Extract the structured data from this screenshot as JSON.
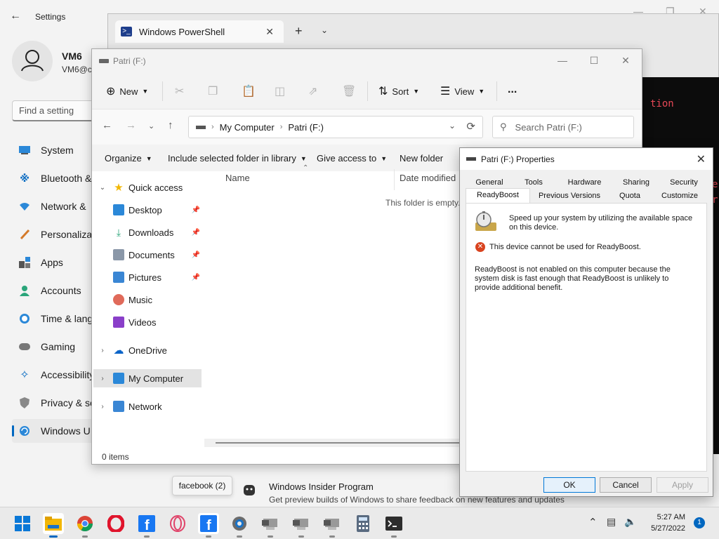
{
  "settings": {
    "title": "Settings",
    "user_name": "VM6",
    "user_email": "VM6@c",
    "search_placeholder": "Find a setting",
    "nav": [
      {
        "label": "System",
        "icon": "monitor-icon"
      },
      {
        "label": "Bluetooth &",
        "icon": "bluetooth-icon"
      },
      {
        "label": "Network &",
        "icon": "wifi-icon"
      },
      {
        "label": "Personaliza",
        "icon": "brush-icon"
      },
      {
        "label": "Apps",
        "icon": "apps-icon"
      },
      {
        "label": "Accounts",
        "icon": "person-icon"
      },
      {
        "label": "Time & lang",
        "icon": "clock-globe-icon"
      },
      {
        "label": "Gaming",
        "icon": "gamepad-icon"
      },
      {
        "label": "Accessibility",
        "icon": "accessibility-icon"
      },
      {
        "label": "Privacy & se",
        "icon": "shield-icon"
      },
      {
        "label": "Windows U",
        "icon": "update-icon"
      }
    ],
    "insider_title": "Windows Insider Program",
    "insider_desc": "Get preview builds of Windows to share feedback on new features and updates"
  },
  "terminal": {
    "tab_title": "Windows PowerShell",
    "console_text_1": "tion",
    "console_text_2": "e",
    "console_text_3": "r"
  },
  "explorer": {
    "title": "Patri (F:)",
    "cmd": {
      "new": "New",
      "sort": "Sort",
      "view": "View",
      "more": "..."
    },
    "breadcrumb": [
      "My Computer",
      "Patri (F:)"
    ],
    "search_placeholder": "Search Patri (F:)",
    "libbar": {
      "organize": "Organize",
      "include": "Include selected folder in library",
      "share": "Give access to",
      "new_folder": "New folder"
    },
    "tree": {
      "quick_access": "Quick access",
      "desktop": "Desktop",
      "downloads": "Downloads",
      "documents": "Documents",
      "pictures": "Pictures",
      "music": "Music",
      "videos": "Videos",
      "onedrive": "OneDrive",
      "mycomputer": "My Computer",
      "network": "Network"
    },
    "columns": {
      "name": "Name",
      "date": "Date modified"
    },
    "empty_message": "This folder is empty.",
    "status": "0 items"
  },
  "properties": {
    "title": "Patri (F:) Properties",
    "tabs_row1": [
      "General",
      "Tools",
      "Hardware",
      "Sharing",
      "Security"
    ],
    "tabs_row2": [
      "ReadyBoost",
      "Previous Versions",
      "Quota",
      "Customize"
    ],
    "active_tab": "ReadyBoost",
    "description": "Speed up your system by utilizing the available space on this device.",
    "error": "This device cannot be used for ReadyBoost.",
    "info": "ReadyBoost is not enabled on this computer because the system disk is fast enough that ReadyBoost is unlikely to provide additional benefit.",
    "buttons": {
      "ok": "OK",
      "cancel": "Cancel",
      "apply": "Apply"
    }
  },
  "tooltip": "facebook (2)",
  "taskbar": {
    "time": "5:27 AM",
    "date": "5/27/2022",
    "notification_count": "1",
    "apps": [
      "start-icon",
      "file-explorer-icon",
      "chrome-icon",
      "opera-icon",
      "facebook-icon",
      "opera-gx-icon",
      "facebook-icon",
      "settings-gear-icon",
      "vm-icon",
      "vm-icon",
      "vm-icon",
      "calculator-icon",
      "terminal-icon"
    ]
  },
  "colors": {
    "accent": "#0067c0",
    "error": "#d9431f",
    "console_error": "#e74856"
  }
}
